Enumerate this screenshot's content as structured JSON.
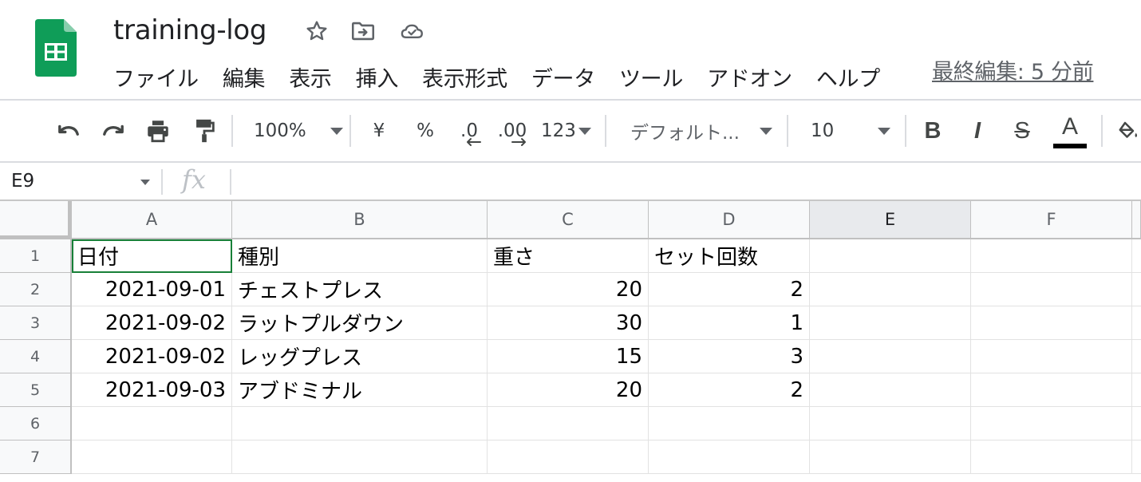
{
  "header": {
    "title": "training-log",
    "icons": [
      "star-icon",
      "move-to-folder-icon",
      "cloud-saved-icon"
    ],
    "menu": [
      "ファイル",
      "編集",
      "表示",
      "挿入",
      "表示形式",
      "データ",
      "ツール",
      "アドオン",
      "ヘルプ"
    ],
    "last_edit": "最終編集: 5 分前",
    "brand_color": "#0f9d58"
  },
  "toolbar": {
    "zoom": "100%",
    "currency": "¥",
    "percent": "%",
    "decrease_decimal": ".0",
    "increase_decimal": ".00",
    "more_formats": "123",
    "font": "デフォルト...",
    "font_size": "10",
    "bold": "B",
    "italic": "I",
    "strikethrough": "S",
    "text_color": "A"
  },
  "formula_bar": {
    "cell_ref": "E9",
    "fx": "fx",
    "value": ""
  },
  "sheet": {
    "columns": [
      "A",
      "B",
      "C",
      "D",
      "E",
      "F"
    ],
    "rows": [
      "1",
      "2",
      "3",
      "4",
      "5",
      "6",
      "7"
    ],
    "cells": [
      [
        "日付",
        "種別",
        "重さ",
        "セット回数",
        "",
        ""
      ],
      [
        "2021-09-01",
        "チェストプレス",
        "20",
        "2",
        "",
        ""
      ],
      [
        "2021-09-02",
        "ラットプルダウン",
        "30",
        "1",
        "",
        ""
      ],
      [
        "2021-09-02",
        "レッグプレス",
        "15",
        "3",
        "",
        ""
      ],
      [
        "2021-09-03",
        "アブドミナル",
        "20",
        "2",
        "",
        ""
      ],
      [
        "",
        "",
        "",
        "",
        "",
        ""
      ],
      [
        "",
        "",
        "",
        "",
        "",
        ""
      ]
    ],
    "active_column": "E",
    "selection_color": "#188038"
  }
}
